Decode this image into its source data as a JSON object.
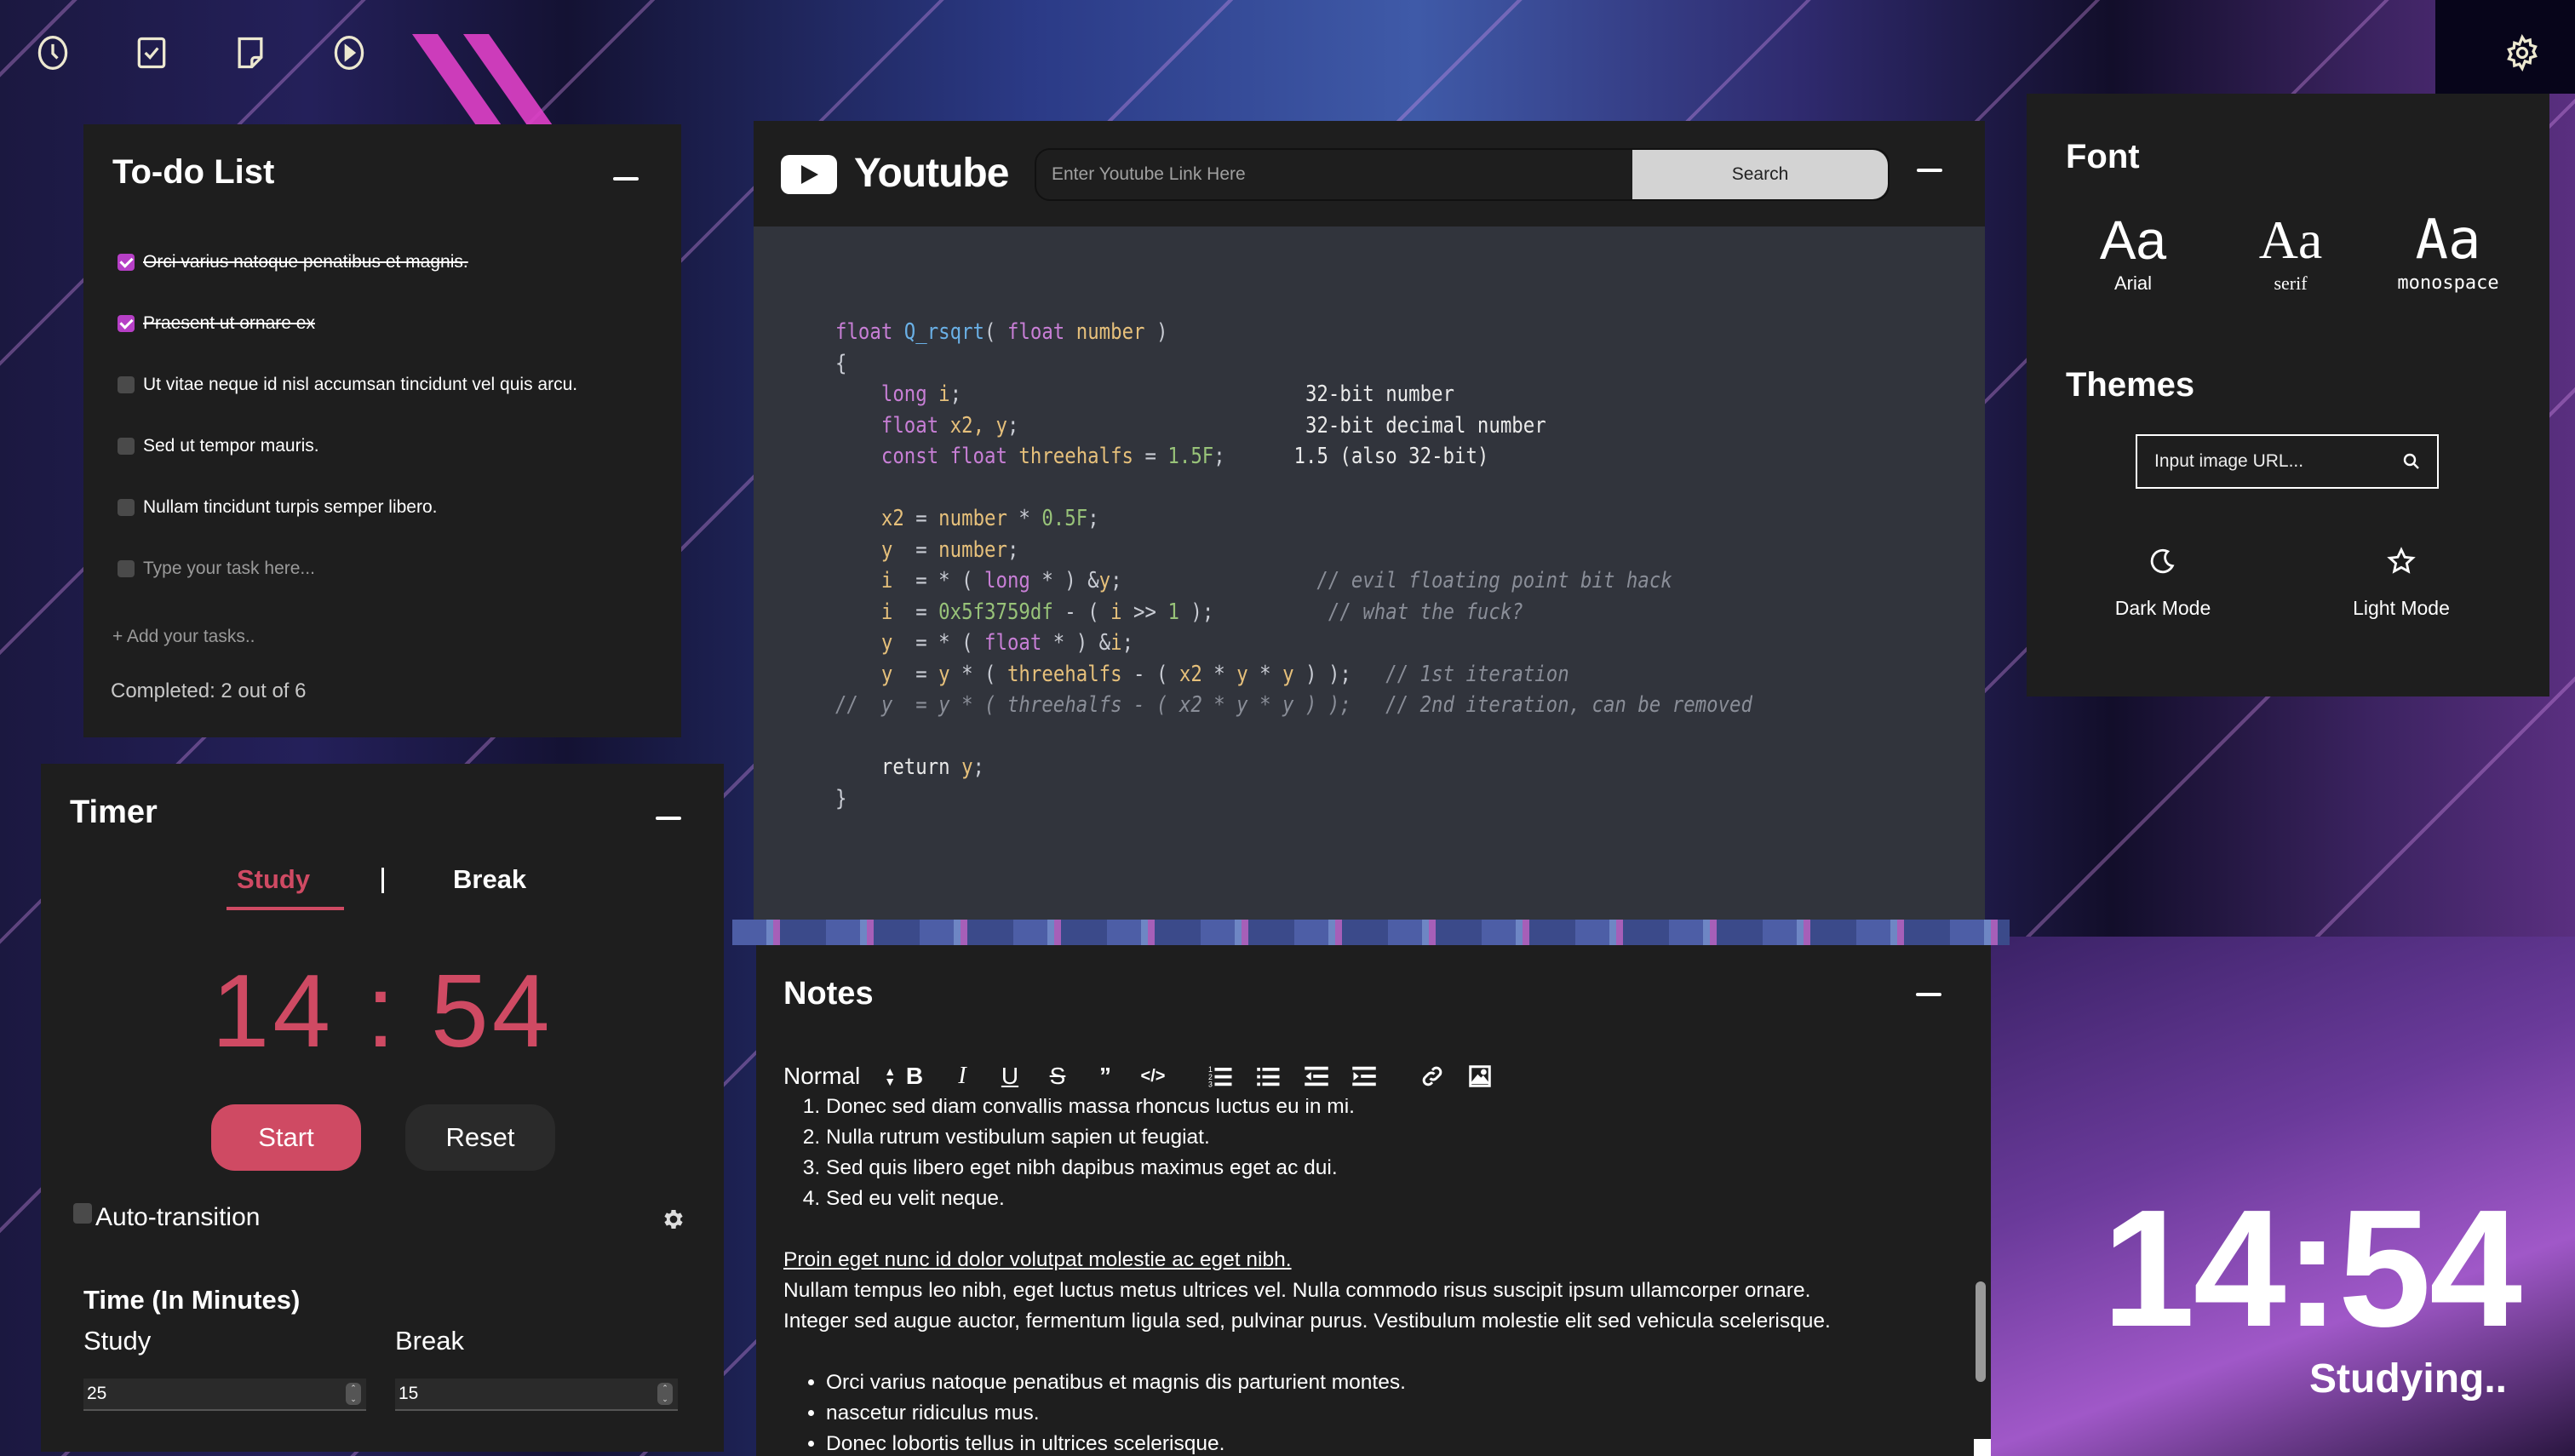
{
  "nav": {
    "icons": [
      "clock-icon",
      "todo-icon",
      "notes-icon",
      "youtube-play-icon"
    ],
    "settings_icon": "gear-icon"
  },
  "todo": {
    "title": "To-do List",
    "items": [
      {
        "text": "Orci varius natoque penatibus et magnis.",
        "done": true
      },
      {
        "text": "Praesent ut ornare ex",
        "done": true
      },
      {
        "text": "Ut vitae neque id nisl accumsan tincidunt vel quis arcu.",
        "done": false
      },
      {
        "text": "Sed ut tempor mauris.",
        "done": false
      },
      {
        "text": "Nullam tincidunt turpis semper libero.",
        "done": false
      }
    ],
    "input_placeholder": "Type your task here...",
    "add_label": "+ Add your tasks..",
    "completed_label": "Completed: 2 out of 6"
  },
  "youtube": {
    "title": "Youtube",
    "input_placeholder": "Enter Youtube Link Here",
    "input_value": "",
    "search_label": "Search",
    "video_code": {
      "l1": "float Q_rsqrt( float number )",
      "l2": "{",
      "l3": "long i;",
      "l4": "float x2, y;",
      "l5": "const float threehalfs = 1.5F;",
      "l6": "x2 = number * 0.5F;",
      "l7": "y  = number;",
      "l8": "i  = * ( long * ) &y;",
      "l9": "i  = 0x5f3759df - ( i >> 1 );",
      "l10": "y  = * ( float * ) &i;",
      "l11": "y  = y * ( threehalfs - ( x2 * y * y ) );",
      "l12": "//  y  = y * ( threehalfs - ( x2 * y * y ) );",
      "l13": "return y;",
      "l14": "}",
      "n1": "32-bit number",
      "n2": "32-bit decimal number",
      "n3": "1.5 (also 32-bit)",
      "c1": "// evil floating point bit hack",
      "c2": "// what the fuck?",
      "c3": "// 1st iteration",
      "c4": "// 2nd iteration, can be removed"
    }
  },
  "font_panel": {
    "title": "Font",
    "sample": "Aa",
    "options": [
      "Arial",
      "serif",
      "monospace"
    ],
    "themes_title": "Themes",
    "url_placeholder": "Input image URL...",
    "url_value": "",
    "theme_options": [
      {
        "label": "Dark Mode",
        "icon": "moon-icon"
      },
      {
        "label": "Light Mode",
        "icon": "star-icon"
      }
    ]
  },
  "timer": {
    "title": "Timer",
    "tabs": [
      "Study",
      "Break"
    ],
    "active_tab": "Study",
    "minutes": "14",
    "separator": ":",
    "seconds": "54",
    "start_label": "Start",
    "reset_label": "Reset",
    "auto_transition_label": "Auto-transition",
    "auto_transition_checked": false,
    "time_heading": "Time (In Minutes)",
    "study_label": "Study",
    "break_label": "Break",
    "study_value": "25",
    "break_value": "15"
  },
  "notes": {
    "title": "Notes",
    "format_select": "Normal",
    "toolbar": [
      "bold",
      "italic",
      "underline",
      "strikethrough",
      "blockquote",
      "code",
      "ordered-list",
      "bullet-list",
      "outdent",
      "indent",
      "link",
      "image"
    ],
    "ordered": [
      "Donec sed diam convallis massa rhoncus luctus eu in mi.",
      "Nulla rutrum vestibulum sapien ut feugiat.",
      "Sed quis libero eget nibh dapibus maximus eget ac dui.",
      "Sed eu velit neque."
    ],
    "underlined": "Proin eget nunc id dolor volutpat molestie ac eget nibh.",
    "paragraph1": "Nullam tempus leo nibh, eget luctus metus ultrices vel. Nulla commodo risus suscipit ipsum ullamcorper ornare.",
    "paragraph2": "Integer sed augue auctor, fermentum ligula sed, pulvinar purus. Vestibulum molestie elit sed vehicula scelerisque.",
    "bullets": [
      "Orci varius natoque penatibus et magnis dis parturient montes.",
      "nascetur ridiculus mus.",
      "Donec lobortis tellus in ultrices scelerisque."
    ]
  },
  "clock": {
    "time": "14:54",
    "status": "Studying.."
  },
  "colors": {
    "accent": "#cf4a63",
    "checkbox_checked": "#b63fc6",
    "panel_bg": "#1e1e1e",
    "video_bg": "#31343c"
  }
}
